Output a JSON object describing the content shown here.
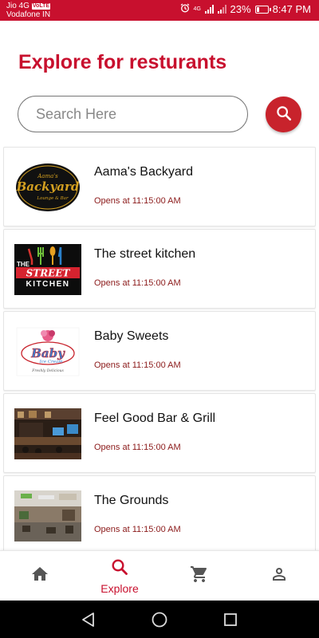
{
  "status_bar": {
    "carrier1": "Jio 4G",
    "volte": "VoLTE",
    "carrier2": "Vodafone IN",
    "battery_percent": "23%",
    "battery_level": 0.23,
    "time": "8:47 PM",
    "network_label": "4G"
  },
  "page": {
    "title": "Explore for resturants"
  },
  "search": {
    "placeholder": "Search Here",
    "value": ""
  },
  "restaurants": [
    {
      "name": "Aama's Backyard",
      "hours": "Opens at 11:15:00 AM",
      "thumb_icon": "backyard-logo"
    },
    {
      "name": "The street kitchen",
      "hours": "Opens at 11:15:00 AM",
      "thumb_icon": "street-kitchen-logo"
    },
    {
      "name": "Baby Sweets",
      "hours": "Opens at 11:15:00 AM",
      "thumb_icon": "baby-sweets-logo"
    },
    {
      "name": "Feel Good Bar & Grill",
      "hours": "Opens at 11:15:00 AM",
      "thumb_icon": "bar-interior-photo"
    },
    {
      "name": "The Grounds",
      "hours": "Opens at 11:15:00 AM",
      "thumb_icon": "restaurant-interior-photo"
    }
  ],
  "thumb_text": {
    "backyard_top": "Aama's",
    "backyard_main": "Backyard",
    "backyard_sub": "Lounge & Bar",
    "street_the": "THE",
    "street_main": "STREET",
    "street_kitchen": "KITCHEN",
    "baby_main": "Baby",
    "baby_sub": "Ice Cream",
    "baby_tag": "Freshly Delicious"
  },
  "bottom_nav": {
    "items": [
      {
        "icon": "home-icon",
        "label": ""
      },
      {
        "icon": "search-icon",
        "label": "Explore"
      },
      {
        "icon": "cart-icon",
        "label": ""
      },
      {
        "icon": "person-icon",
        "label": ""
      }
    ],
    "active_index": 1
  },
  "colors": {
    "brand": "#c8102e",
    "accent_button": "#c8232c",
    "hours_text": "#8b1a1a",
    "inactive_icon": "#555555"
  }
}
